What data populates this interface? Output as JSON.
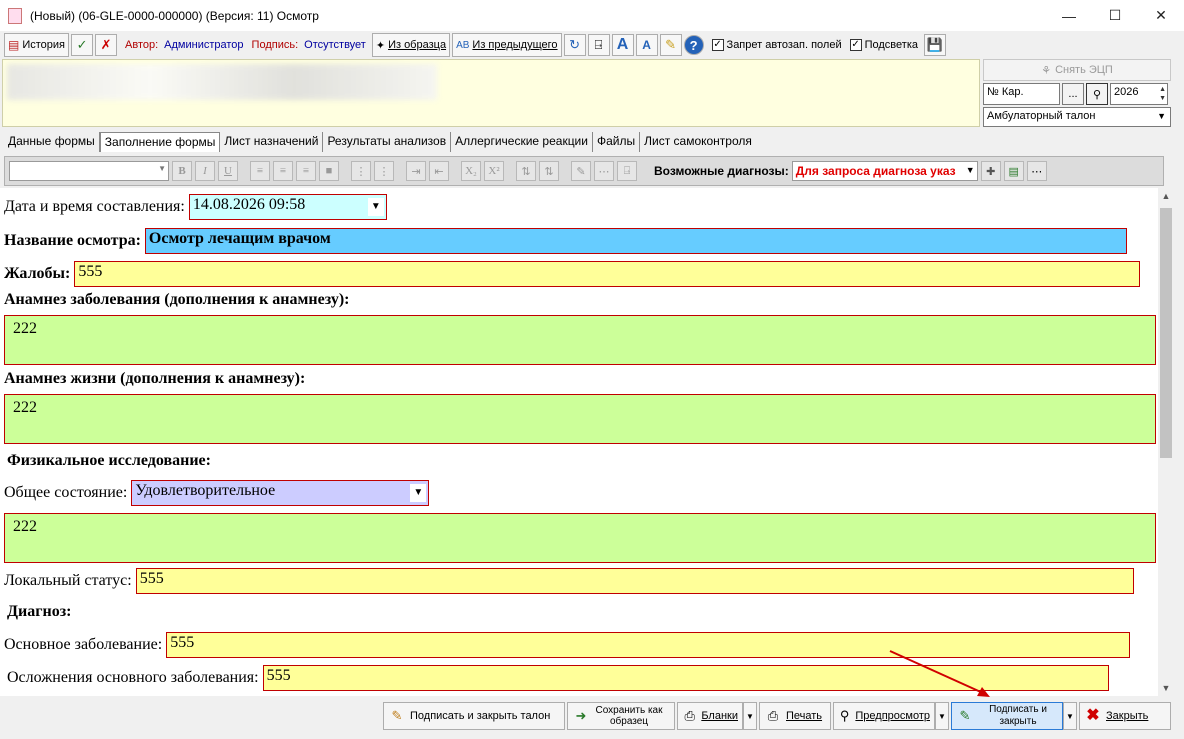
{
  "window": {
    "title": "(Новый) (06-GLE-0000-000000) (Версия: 11) Осмотр"
  },
  "toolbar": {
    "history_label": "История",
    "author_label": "Автор:",
    "author_value": "Администратор",
    "signature_label": "Подпись:",
    "signature_value": "Отсутствует",
    "from_sample_label": "Из образца",
    "from_previous_label": "Из предыдущего",
    "ban_autofill_label": "Запрет автозап. полей",
    "highlight_label": "Подсветка",
    "ban_autofill_checked": true,
    "highlight_checked": true
  },
  "right_panel": {
    "remove_ecp_label": "Снять ЭЦП",
    "card_number_placeholder": "№ Кар.",
    "dots": "...",
    "year": "2026",
    "talon_type": "Амбулаторный талон"
  },
  "tabs": [
    {
      "label": "Данные формы",
      "active": false
    },
    {
      "label": "Заполнение формы",
      "active": true
    },
    {
      "label": "Лист назначений",
      "active": false
    },
    {
      "label": "Результаты анализов",
      "active": false
    },
    {
      "label": "Аллергические реакции",
      "active": false
    },
    {
      "label": "Файлы",
      "active": false
    },
    {
      "label": "Лист самоконтроля",
      "active": false
    }
  ],
  "editor_toolbar": {
    "possible_diagnoses_label": "Возможные диагнозы:",
    "diagnoses_placeholder": "Для запроса диагноза указ"
  },
  "form": {
    "datetime_label": "Дата и время составления:",
    "datetime_value": "14.08.2026 09:58",
    "exam_name_label": "Название осмотра:",
    "exam_name_value": "Осмотр лечащим врачом",
    "complaints_label": "Жалобы:",
    "complaints_value": "555",
    "disease_history_label": "Анамнез заболевания (дополнения к анамнезу):",
    "disease_history_value": "222",
    "life_history_label": "Анамнез жизни (дополнения к анамнезу):",
    "life_history_value": "222",
    "physical_exam_label": "Физикальное исследование:",
    "general_state_label": "Общее состояние:",
    "general_state_value": "Удовлетворительное",
    "general_state_notes": "222",
    "local_status_label": "Локальный статус:",
    "local_status_value": "555",
    "diagnosis_label": "Диагноз:",
    "main_disease_label": "Основное заболевание:",
    "main_disease_value": "555",
    "complications_label": "Осложнения основного заболевания:",
    "complications_value": "555"
  },
  "bottom_buttons": {
    "sign_close_talon": "Подписать и закрыть талон",
    "save_as_sample": "Сохранить как образец",
    "blanks": "Бланки",
    "print": "Печать",
    "preview": "Предпросмотр",
    "sign_and_close": "Подписать и закрыть",
    "close": "Закрыть"
  },
  "colors": {
    "required_border": "#c00000",
    "green_field": "#ccff99",
    "yellow_field": "#ffff99",
    "blue_field": "#66ccff",
    "lilac_field": "#ccccff",
    "annotation_arrow": "#d00000"
  }
}
